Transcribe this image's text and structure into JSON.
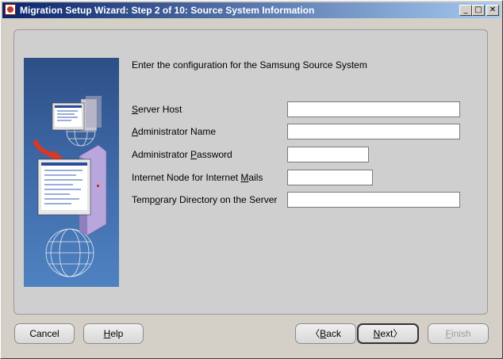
{
  "window": {
    "title": "Migration Setup Wizard:  Step 2 of 10: Source System Information",
    "min_glyph": "_",
    "max_glyph": "□",
    "close_glyph": "✕"
  },
  "instruction": "Enter the configuration for the Samsung Source System",
  "fields": [
    {
      "prefix": "",
      "mnemonic": "S",
      "suffix": "erver Host",
      "value": ""
    },
    {
      "prefix": "",
      "mnemonic": "A",
      "suffix": "dministrator Name",
      "value": ""
    },
    {
      "prefix": "Administrator ",
      "mnemonic": "P",
      "suffix": "assword",
      "value": ""
    },
    {
      "prefix": "Internet Node for Internet ",
      "mnemonic": "M",
      "suffix": "ails",
      "value": ""
    },
    {
      "prefix": "Temp",
      "mnemonic": "o",
      "suffix": "rary Directory on the Server",
      "value": ""
    }
  ],
  "buttons": {
    "cancel": "Cancel",
    "help_mnemonic": "H",
    "help_rest": "elp",
    "back_arrow": "〈",
    "back_mnemonic": "B",
    "back_rest": "ack",
    "next_mnemonic": "N",
    "next_rest": "ext",
    "next_arrow": "〉",
    "finish_mnemonic": "F",
    "finish_rest": "inish"
  }
}
